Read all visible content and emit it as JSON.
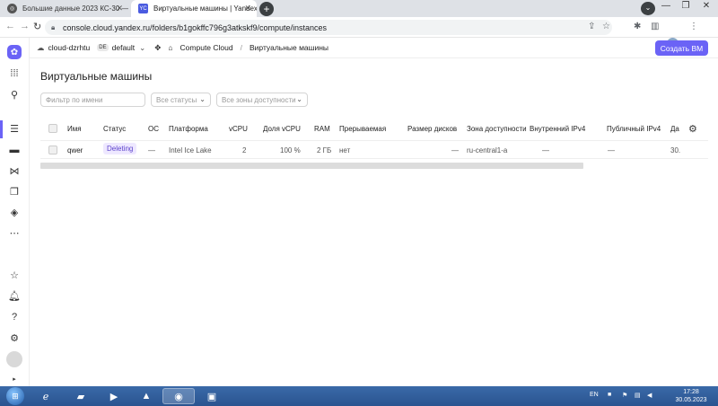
{
  "browser": {
    "tabs": [
      {
        "label": "Большие данные 2023 КС-30 —",
        "favicon_text": "",
        "active": false
      },
      {
        "label": "Виртуальные машины | Yandex",
        "favicon_text": "YC",
        "active": true
      }
    ],
    "new_tab_label": "+",
    "window_controls": {
      "dropdown": "⌄",
      "minimize": "—",
      "maximize": "❐",
      "close": "✕"
    },
    "nav": {
      "back": "←",
      "forward": "→",
      "reload": "↻"
    },
    "address": "console.cloud.yandex.ru/folders/b1gokffc796g3atkskf9/compute/instances"
  },
  "console": {
    "breadcrumb": {
      "cloud": "cloud-dzrhtu",
      "folder_badge": "DE",
      "folder": "default",
      "service": "Compute Cloud",
      "separator": "/",
      "page": "Виртуальные машины"
    },
    "create_button": "Создать ВМ"
  },
  "main": {
    "title": "Виртуальные машины",
    "filters": {
      "name_placeholder": "Фильтр по имени",
      "status": "Все статусы",
      "zone": "Все зоны доступности"
    },
    "table": {
      "columns": [
        "Имя",
        "Статус",
        "ОС",
        "Платформа",
        "vCPU",
        "Доля vCPU",
        "RAM",
        "Прерываемая",
        "Размер дисков",
        "Зона доступности",
        "Внутренний IPv4",
        "Публичный IPv4",
        "Да"
      ],
      "rows": [
        {
          "name": "qwer",
          "status": "Deleting",
          "os": "—",
          "platform": "Intel Ice Lake",
          "vcpu": "2",
          "vcpu_share": "100 %",
          "ram": "2 ГБ",
          "preemptible": "нет",
          "disk_size": "—",
          "zone": "ru-central1-a",
          "internal_ipv4": "—",
          "public_ipv4": "—",
          "date": "30."
        }
      ]
    }
  },
  "taskbar": {
    "language": "EN",
    "time": "17:28",
    "date": "30.05.2023"
  },
  "colors": {
    "accent": "#6b63f6",
    "status_bg": "#eee8ff",
    "status_text": "#5d44cc"
  }
}
